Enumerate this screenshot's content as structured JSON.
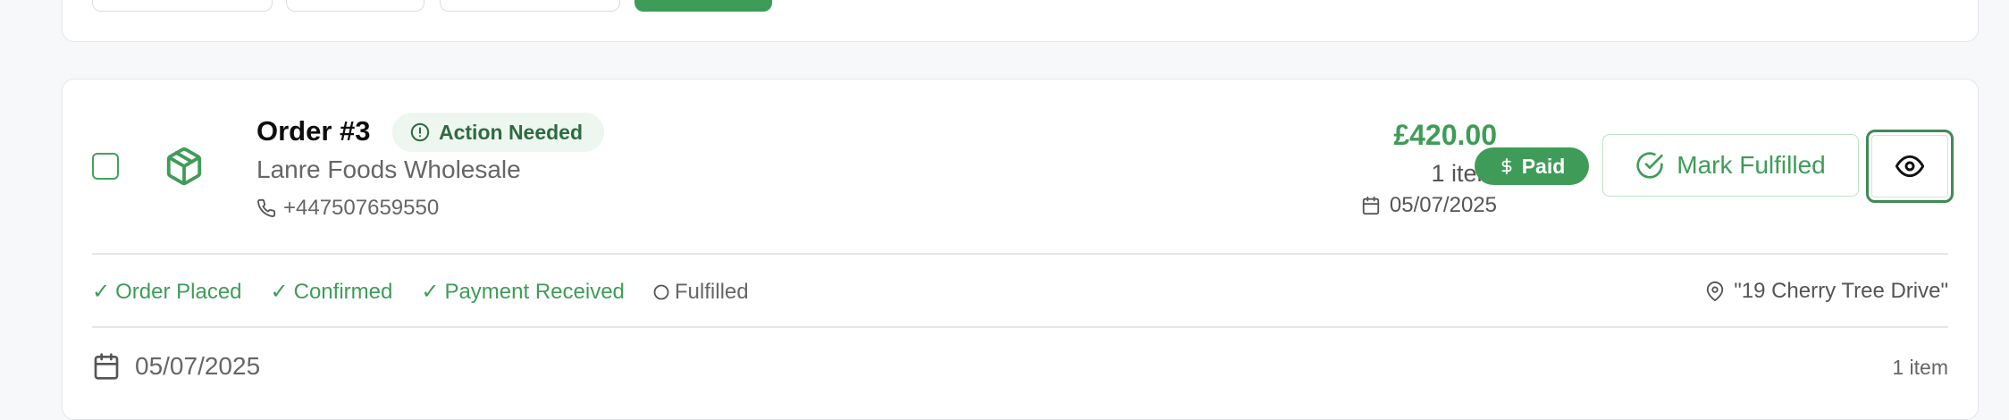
{
  "order": {
    "title": "Order #3",
    "status_badge": "Action Needed",
    "customer": "Lanre Foods Wholesale",
    "phone": "+447507659550",
    "amount": "£420.00",
    "items_count": "1 item",
    "date": "05/07/2025",
    "payment_badge": "Paid",
    "mark_fulfilled_label": "Mark Fulfilled",
    "progress": [
      {
        "label": "Order Placed",
        "done": true
      },
      {
        "label": "Confirmed",
        "done": true
      },
      {
        "label": "Payment Received",
        "done": true
      },
      {
        "label": "Fulfilled",
        "done": false
      }
    ],
    "address": "\"19 Cherry Tree Drive\"",
    "footer_date": "05/07/2025",
    "footer_items": "1 item"
  },
  "colors": {
    "accent_green": "#3f9c58",
    "badge_bg": "#eef6f0",
    "muted_text": "#666666"
  },
  "icons": {
    "order": "package-icon",
    "status": "alert-circle-icon",
    "phone": "phone-icon",
    "date": "calendar-icon",
    "paid": "dollar-icon",
    "fulfill": "check-circle-icon",
    "view": "eye-icon",
    "address": "map-pin-icon",
    "step_done": "check-icon",
    "step_pending": "circle-icon"
  }
}
